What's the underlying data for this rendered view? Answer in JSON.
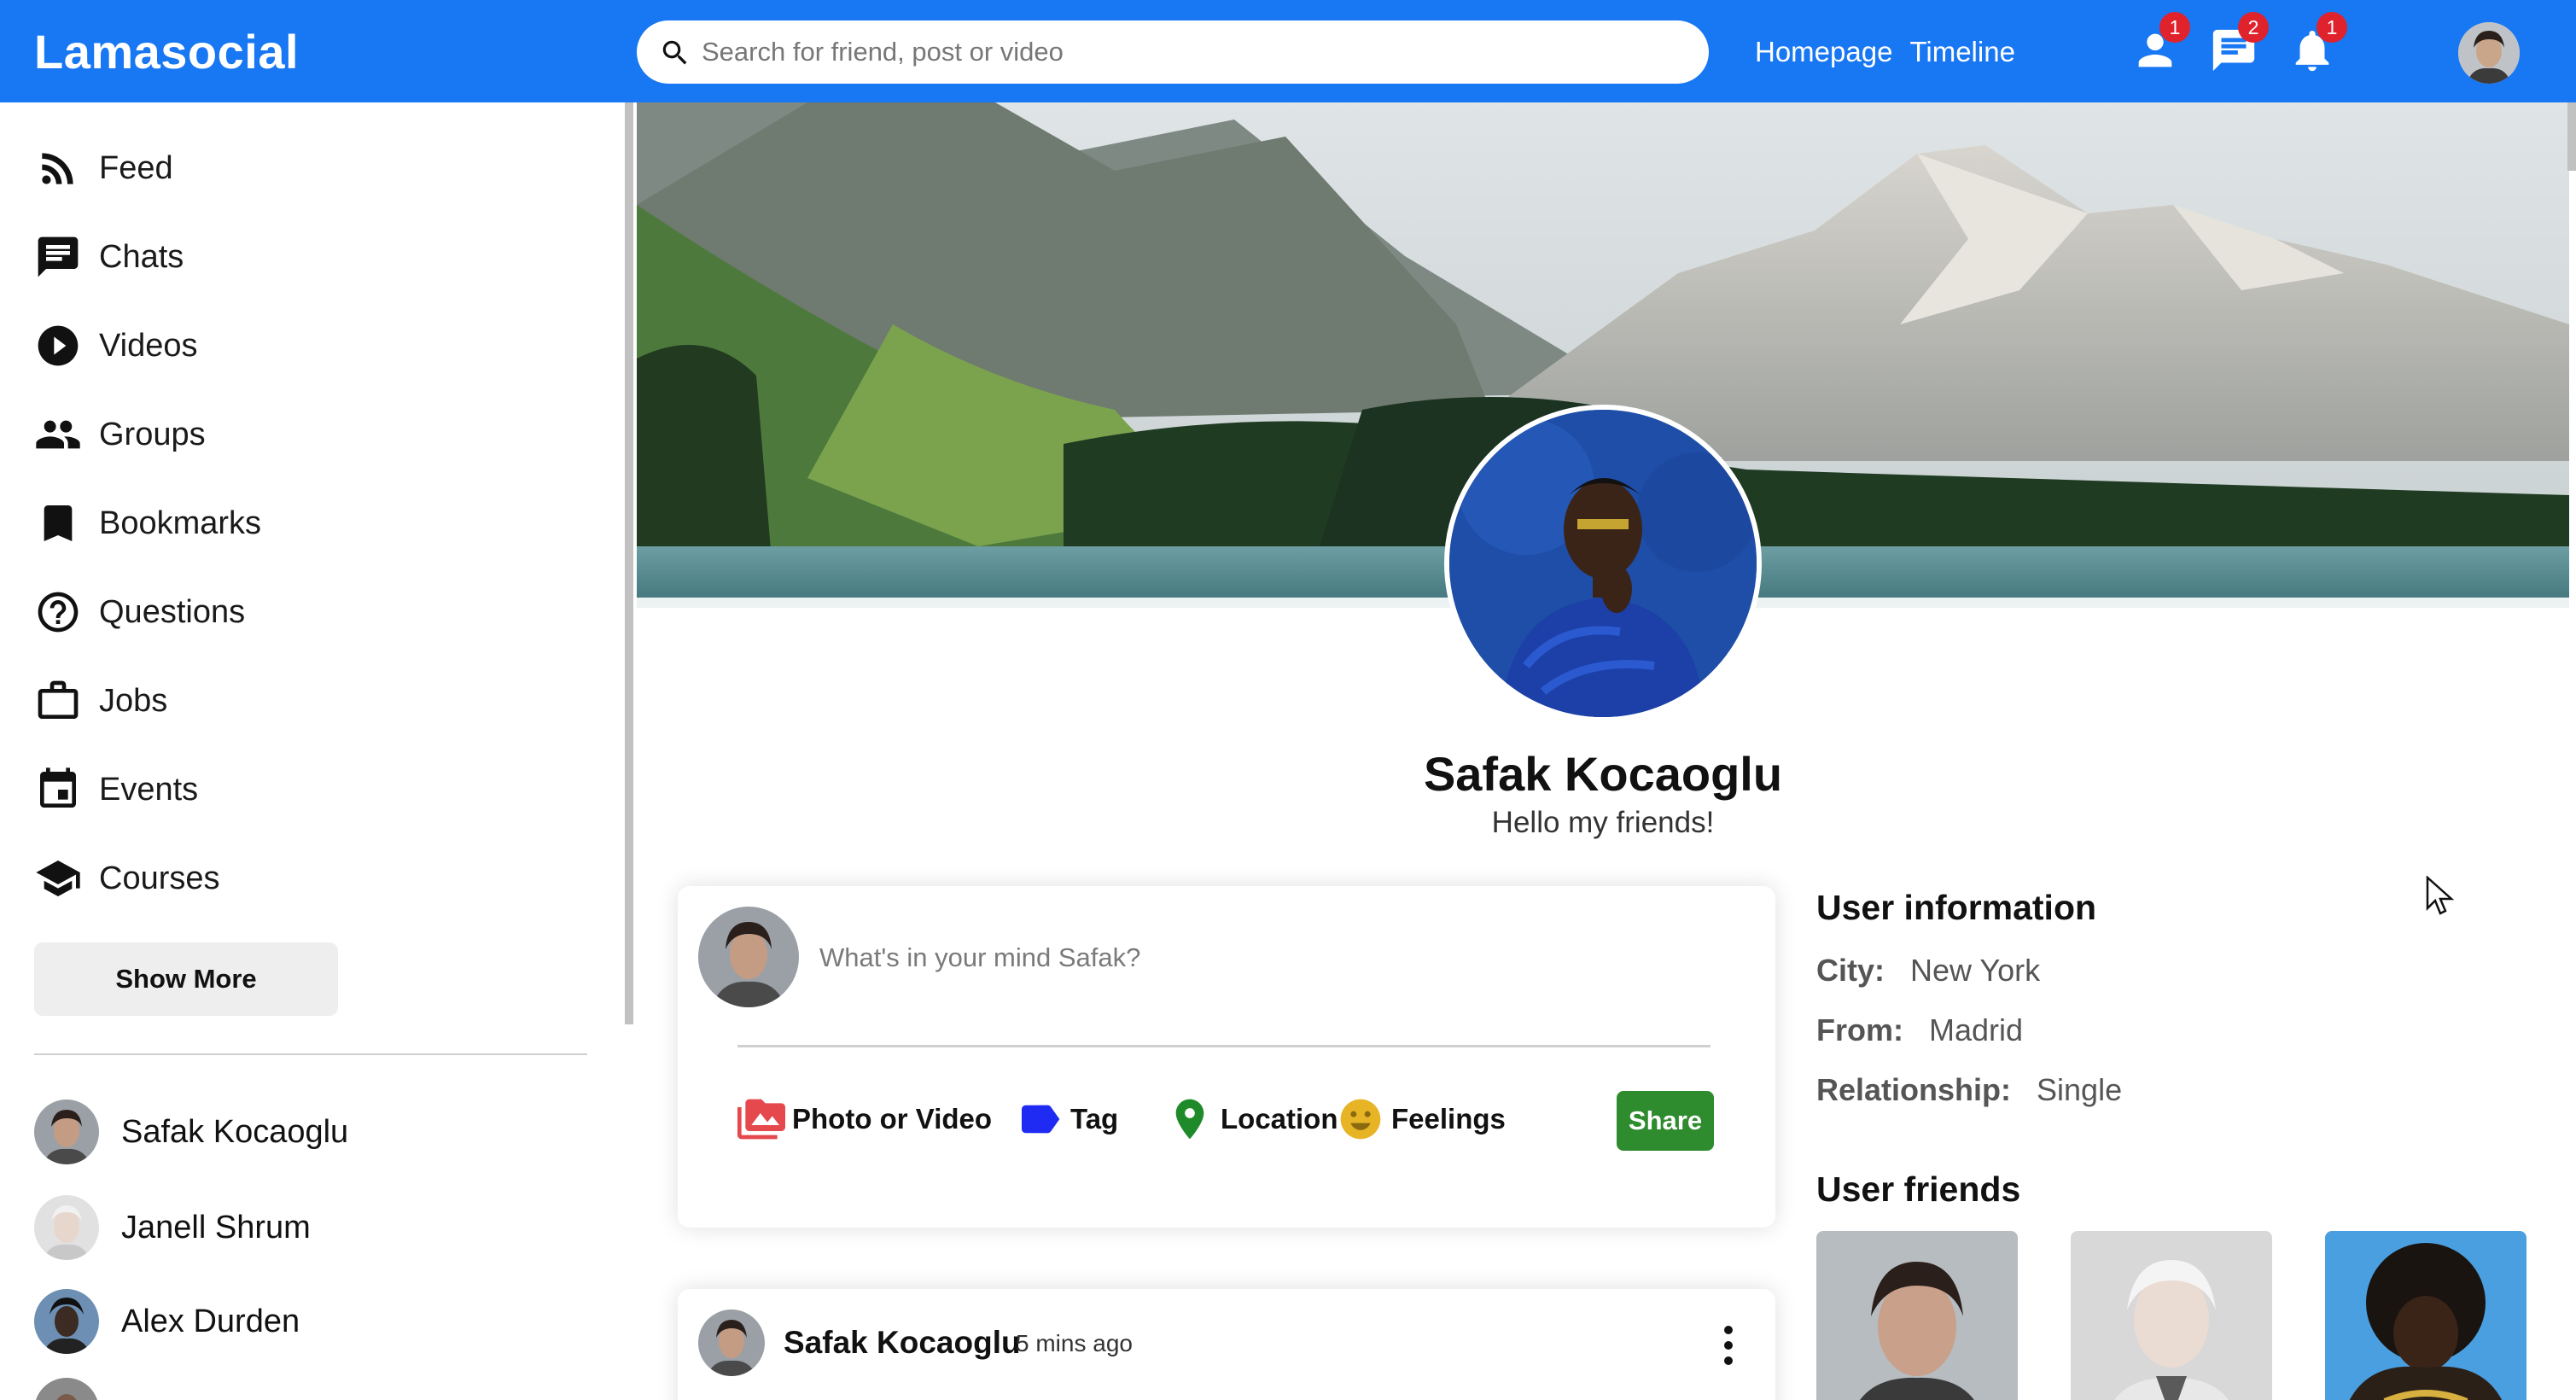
{
  "topbar": {
    "logo": "Lamasocial",
    "search_placeholder": "Search for friend, post or video",
    "links": [
      "Homepage",
      "Timeline"
    ],
    "icons": [
      {
        "name": "person-icon",
        "badge": "1"
      },
      {
        "name": "chat-icon",
        "badge": "2"
      },
      {
        "name": "notifications-icon",
        "badge": "1"
      }
    ],
    "accent_color": "#1877f2",
    "badge_color": "#e0222c"
  },
  "sidebar": {
    "items": [
      {
        "label": "Feed",
        "icon": "rss-feed-icon"
      },
      {
        "label": "Chats",
        "icon": "chat-icon"
      },
      {
        "label": "Videos",
        "icon": "play-circle-icon"
      },
      {
        "label": "Groups",
        "icon": "group-icon"
      },
      {
        "label": "Bookmarks",
        "icon": "bookmark-icon"
      },
      {
        "label": "Questions",
        "icon": "help-outline-icon"
      },
      {
        "label": "Jobs",
        "icon": "work-outline-icon"
      },
      {
        "label": "Events",
        "icon": "event-icon"
      },
      {
        "label": "Courses",
        "icon": "school-icon"
      }
    ],
    "show_more": "Show More",
    "friends": [
      "Safak Kocaoglu",
      "Janell Shrum",
      "Alex Durden"
    ]
  },
  "profile": {
    "name": "Safak Kocaoglu",
    "description": "Hello my friends!"
  },
  "share": {
    "placeholder": "What's in your mind Safak?",
    "options": [
      {
        "label": "Photo or Video",
        "icon": "perm-media-icon",
        "color": "#e5484d"
      },
      {
        "label": "Tag",
        "icon": "label-icon",
        "color": "#1f2bf2"
      },
      {
        "label": "Location",
        "icon": "room-icon",
        "color": "#1e8a2a"
      },
      {
        "label": "Feelings",
        "icon": "emoji-emotions-icon",
        "color": "#e7b426"
      }
    ],
    "button": "Share",
    "button_color": "#2e8b2e"
  },
  "post": {
    "username": "Safak Kocaoglu",
    "time": "5 mins ago"
  },
  "user_info": {
    "title": "User information",
    "rows": [
      {
        "key": "City:",
        "value": "New York"
      },
      {
        "key": "From:",
        "value": "Madrid"
      },
      {
        "key": "Relationship:",
        "value": "Single"
      }
    ],
    "friends_title": "User friends"
  }
}
